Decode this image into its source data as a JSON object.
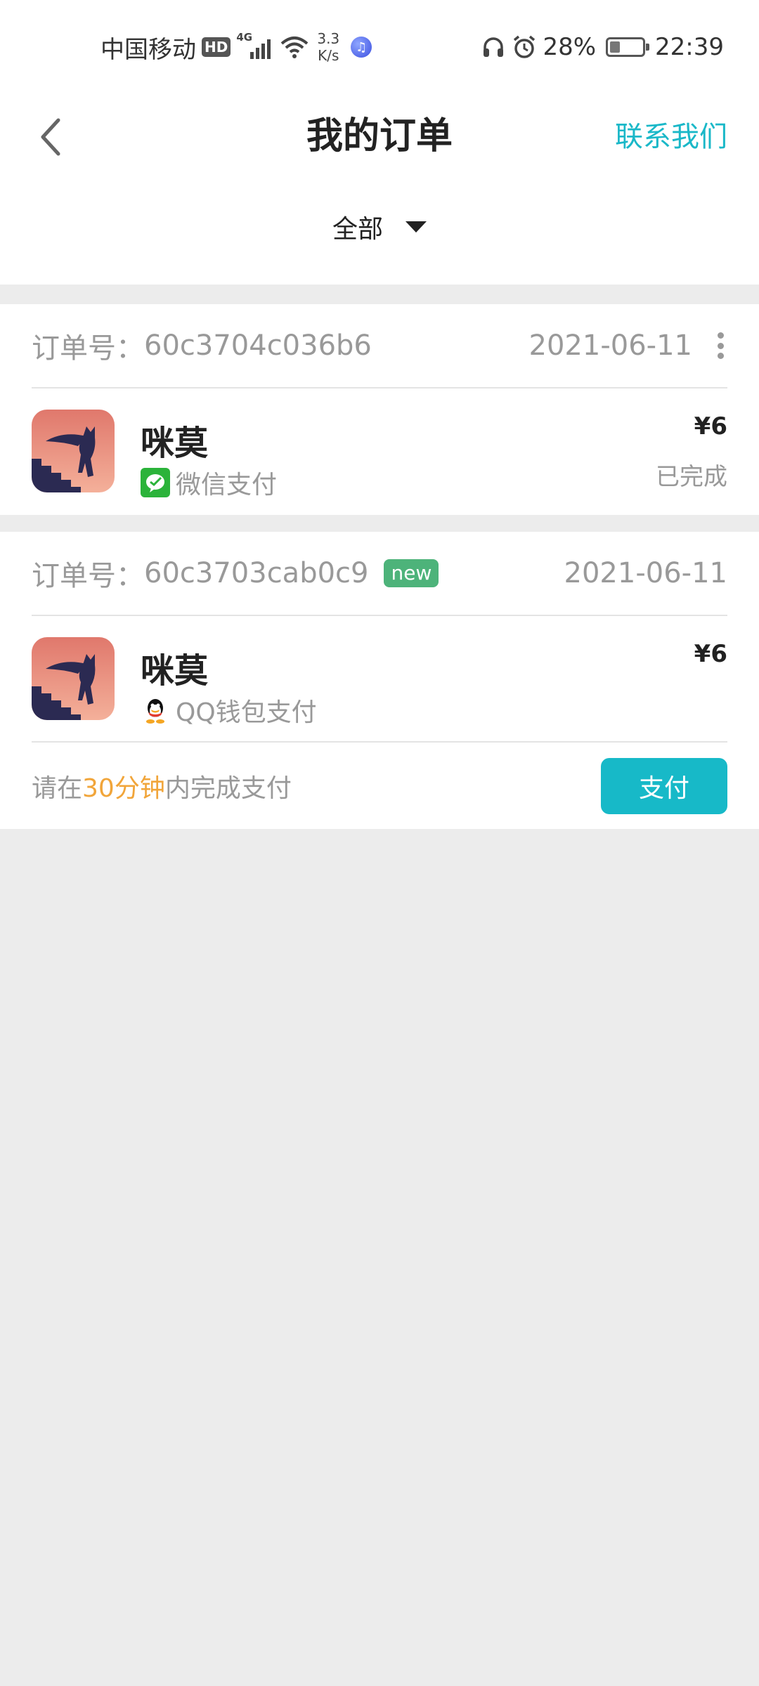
{
  "status_bar": {
    "carrier": "中国移动",
    "hd": "HD",
    "network": "4G",
    "speed_value": "3.3",
    "speed_unit": "K/s",
    "battery": "28%",
    "time": "22:39"
  },
  "header": {
    "title": "我的订单",
    "contact": "联系我们"
  },
  "filter": {
    "selected": "全部"
  },
  "orders": [
    {
      "order_no_label": "订单号：",
      "order_no": "60c3704c036b6",
      "date": "2021-06-11",
      "app_name": "咪莫",
      "payment": "微信支付",
      "payment_icon": "wechat-pay-icon",
      "price": "¥6",
      "status": "已完成"
    },
    {
      "order_no_label": "订单号：",
      "order_no": "60c3703cab0c9",
      "badge": "new",
      "date": "2021-06-11",
      "app_name": "咪莫",
      "payment": "QQ钱包支付",
      "payment_icon": "qq-wallet-icon",
      "price": "¥6",
      "notice_prefix": "请在",
      "notice_highlight": "30分钟",
      "notice_suffix": "内完成支付",
      "pay_button": "支付"
    }
  ],
  "colors": {
    "accent": "#17b9c8",
    "highlight": "#f1a53a",
    "new_badge": "#4db37a"
  }
}
